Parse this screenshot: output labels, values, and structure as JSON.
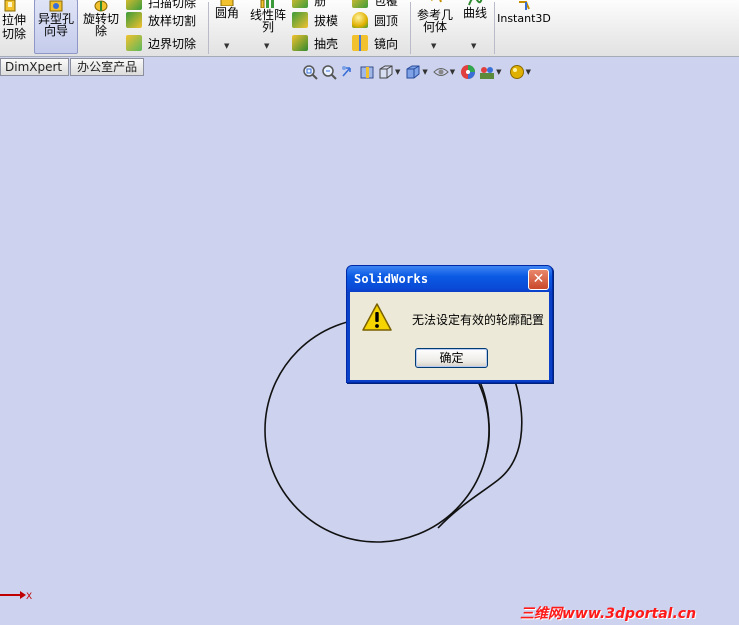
{
  "ribbon": {
    "extrude_cut": "拉伸切除",
    "hole_wizard_line1": "异型孔",
    "hole_wizard_line2": "向导",
    "revolve_cut_line1": "旋转切",
    "revolve_cut_line2": "除",
    "swept_cut": "扫描切除",
    "lofted_cut": "放样切割",
    "boundary_cut": "边界切除",
    "fillet": "圆角",
    "linear_pattern_line1": "线性阵",
    "linear_pattern_line2": "列",
    "rib": "筋",
    "draft": "拔模",
    "shell": "抽壳",
    "wrap": "包覆",
    "dome": "圆顶",
    "mirror": "镜向",
    "ref_geom_line1": "参考几",
    "ref_geom_line2": "何体",
    "curves": "曲线",
    "instant3d": "Instant3D"
  },
  "tabs": [
    "DimXpert",
    "办公室产品"
  ],
  "view_toolbar": [
    "zoom-to-fit-icon",
    "zoom-to-area-icon",
    "previous-view-icon",
    "section-view-icon",
    "view-orientation-icon",
    "display-style-icon",
    "hide-show-items-icon",
    "edit-appearance-icon",
    "apply-scene-icon",
    "view-settings-icon"
  ],
  "dialog": {
    "title": "SolidWorks",
    "message": "无法设定有效的轮廓配置",
    "ok_label": "确定"
  },
  "axis_label": "X",
  "watermark": "三维网www.3dportal.cn",
  "colors": {
    "canvas": "#cdd3ee",
    "xp_title_blue": "#0a5ae4",
    "close_red": "#c9482a",
    "warning_yellow": "#f5d400",
    "watermark_red": "#ff1a1a"
  }
}
